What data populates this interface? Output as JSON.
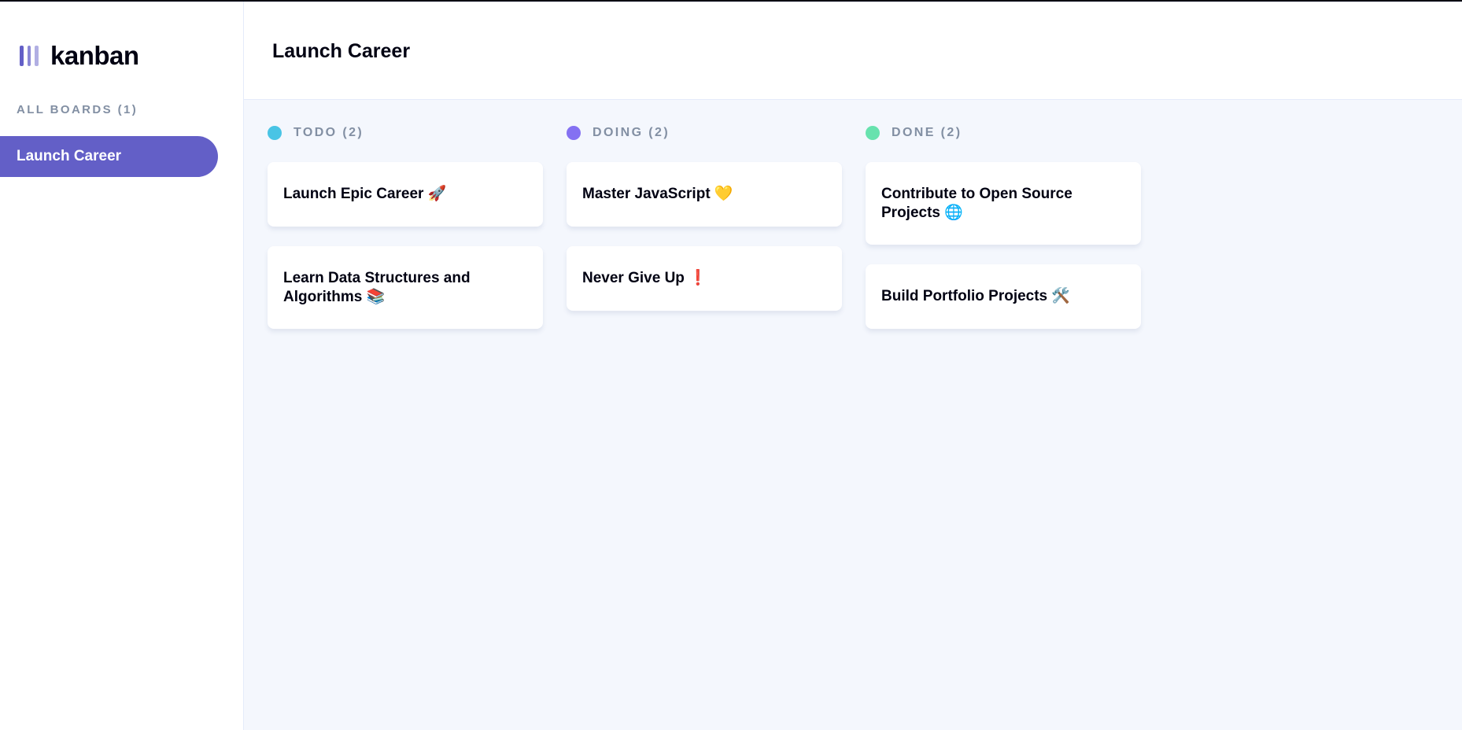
{
  "app": {
    "name": "kanban"
  },
  "sidebar": {
    "all_boards_label": "ALL BOARDS (1)",
    "boards": [
      {
        "label": "Launch Career",
        "active": true
      }
    ]
  },
  "header": {
    "board_title": "Launch Career"
  },
  "columns": [
    {
      "title": "TODO (2)",
      "color": "#49c4e5",
      "cards": [
        {
          "title": "Launch Epic Career 🚀"
        },
        {
          "title": "Learn Data Structures and Algorithms 📚"
        }
      ]
    },
    {
      "title": "DOING (2)",
      "color": "#8471f2",
      "cards": [
        {
          "title": "Master JavaScript 💛"
        },
        {
          "title": "Never Give Up ❗"
        }
      ]
    },
    {
      "title": "DONE (2)",
      "color": "#67e2ae",
      "cards": [
        {
          "title": "Contribute to Open Source Projects 🌐"
        },
        {
          "title": "Build Portfolio Projects 🛠️"
        }
      ]
    }
  ],
  "colors": {
    "accent": "#635fc7",
    "background": "#f4f7fd",
    "muted_text": "#828fa3"
  }
}
